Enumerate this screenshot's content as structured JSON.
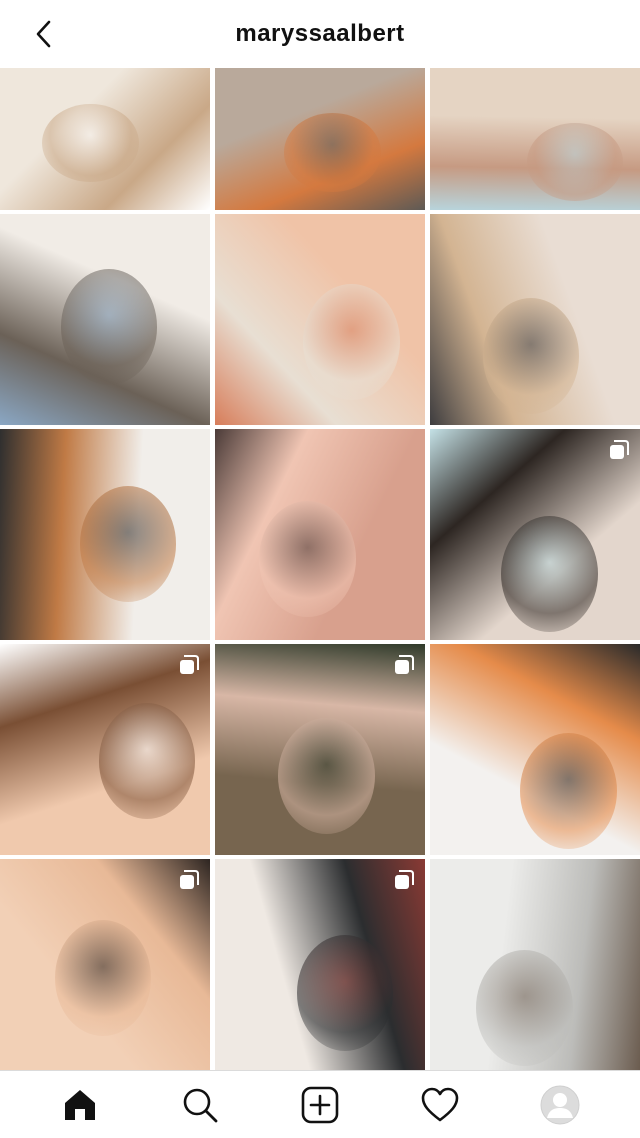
{
  "header": {
    "username": "maryssaalbert",
    "back_icon": "chevron-left-icon"
  },
  "grid": {
    "posts": [
      {
        "name": "kitchen-island-photo",
        "colors": [
          "#efe7dc",
          "#c9a887",
          "#ffffff"
        ],
        "multi": false
      },
      {
        "name": "toddler-on-rug-photo",
        "colors": [
          "#b9a99b",
          "#d4793f",
          "#5e5a55"
        ],
        "multi": false
      },
      {
        "name": "hug-closeup-photo",
        "colors": [
          "#e5d4c3",
          "#c69a82",
          "#b8d4dc"
        ],
        "multi": false
      },
      {
        "name": "kitchen-shelves-portrait-photo",
        "colors": [
          "#f1ece6",
          "#6b6157",
          "#8aa7c4"
        ],
        "multi": false
      },
      {
        "name": "girls-bedroom-photo",
        "colors": [
          "#f0c3a7",
          "#e8dfd3",
          "#d77d5a"
        ],
        "multi": false
      },
      {
        "name": "two-sisters-photo",
        "colors": [
          "#e9ddd3",
          "#d3b492",
          "#3e3d3f"
        ],
        "multi": false
      },
      {
        "name": "mirror-selfie-photo",
        "colors": [
          "#f1eeea",
          "#c07a45",
          "#2f2f2f"
        ],
        "multi": false
      },
      {
        "name": "pink-camera-photo",
        "colors": [
          "#d8a08d",
          "#f0c5b3",
          "#4b3b38"
        ],
        "multi": false
      },
      {
        "name": "family-selfie-photo",
        "colors": [
          "#e3d6cc",
          "#2d2622",
          "#c4e1e6"
        ],
        "multi": true
      },
      {
        "name": "peach-bedroom-corner-photo",
        "colors": [
          "#f0c9ad",
          "#7a4f34",
          "#ffffff"
        ],
        "multi": true
      },
      {
        "name": "front-porch-kids-photo",
        "colors": [
          "#77654f",
          "#d8b7a6",
          "#2f3a2a"
        ],
        "multi": true
      },
      {
        "name": "toys-gift-photo",
        "colors": [
          "#f3f1ef",
          "#e58b4a",
          "#2a2a2a"
        ],
        "multi": false
      },
      {
        "name": "wall-quote-bedroom-photo",
        "colors": [
          "#f2d0b6",
          "#e8b997",
          "#2d2521"
        ],
        "multi": true
      },
      {
        "name": "mom-hugging-child-photo",
        "colors": [
          "#efe9e3",
          "#2b2d2f",
          "#8a3a34"
        ],
        "multi": true
      },
      {
        "name": "kitchen-sink-window-photo",
        "colors": [
          "#ececea",
          "#bcbcb9",
          "#6b5c4f"
        ],
        "multi": false
      }
    ]
  },
  "bottom_nav": {
    "items": [
      {
        "name": "home-icon",
        "active": true
      },
      {
        "name": "search-icon",
        "active": false
      },
      {
        "name": "new-post-icon",
        "active": false
      },
      {
        "name": "activity-heart-icon",
        "active": false
      },
      {
        "name": "profile-avatar-icon",
        "active": false
      }
    ]
  }
}
